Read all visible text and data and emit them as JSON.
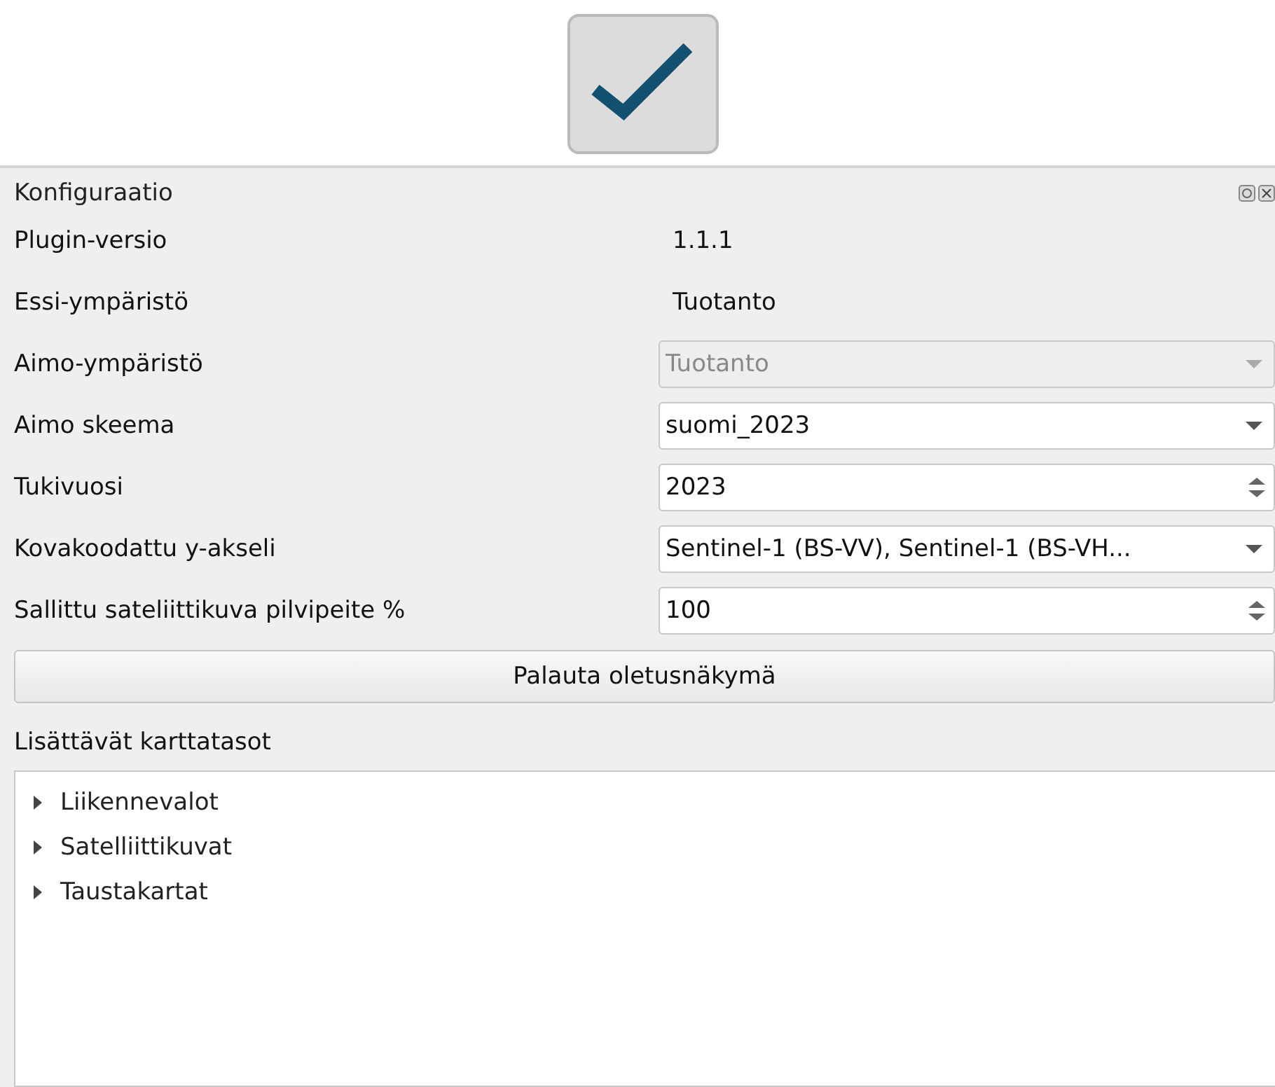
{
  "toolbar": {
    "check_button": {
      "selected": false
    }
  },
  "panel": {
    "title": "Konfiguraatio",
    "fields": [
      {
        "label": "Plugin-versio",
        "kind": "text",
        "value": "1.1.1"
      },
      {
        "label": "Essi-ympäristö",
        "kind": "text",
        "value": "Tuotanto"
      },
      {
        "label": "Aimo-ympäristö",
        "kind": "combo",
        "value": "Tuotanto",
        "disabled": true
      },
      {
        "label": "Aimo skeema",
        "kind": "combo",
        "value": "suomi_2023",
        "disabled": false
      },
      {
        "label": "Tukivuosi",
        "kind": "spin",
        "value": "2023",
        "disabled": false
      },
      {
        "label": "Kovakoodattu y-akseli",
        "kind": "combo",
        "value": "Sentinel-1 (BS-VV), Sentinel-1 (BS-VH...",
        "disabled": false
      },
      {
        "label": "Sallittu sateliittikuva pilvipeite %",
        "kind": "spin",
        "value": "100",
        "disabled": false
      }
    ],
    "reset_button": "Palauta oletusnäkymä",
    "layers_label": "Lisättävät karttatasot",
    "layers": [
      {
        "label": "Liikennevalot",
        "expanded": false
      },
      {
        "label": "Satelliittikuvat",
        "expanded": false
      },
      {
        "label": "Taustakartat",
        "expanded": false
      }
    ]
  }
}
